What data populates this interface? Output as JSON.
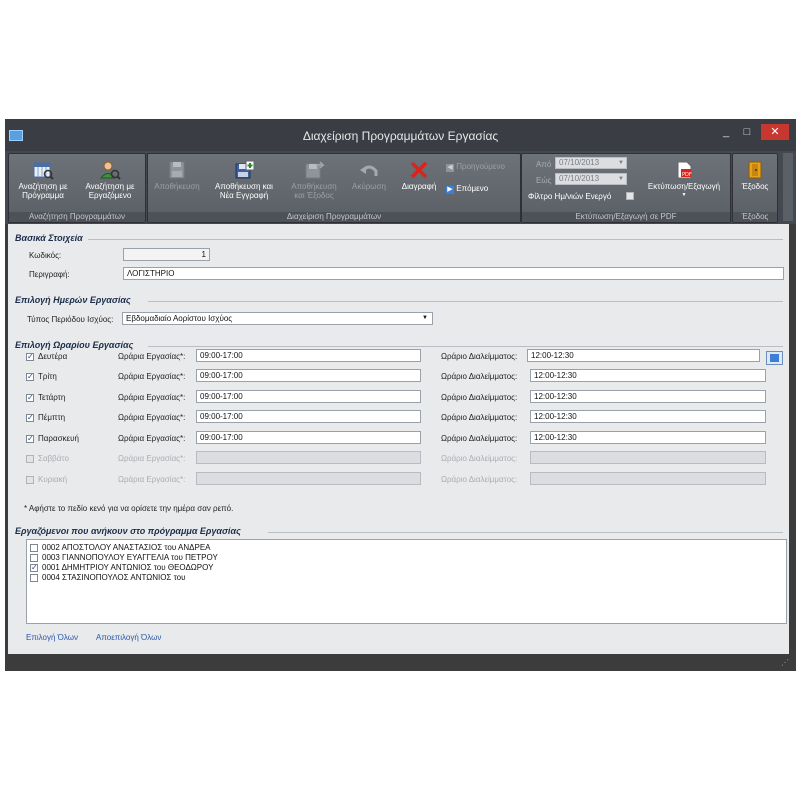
{
  "window": {
    "title": "Διαχείριση Προγραμμάτων Εργασίας",
    "minimize": "_",
    "maximize": "□",
    "close": "✕"
  },
  "ribbon": {
    "groups": {
      "search": "Αναζήτηση Προγραμμάτων",
      "manage": "Διαχείριση Προγραμμάτων",
      "print": "Εκτύπωση/Εξαγωγή σε PDF",
      "exit": "Έξοδος"
    },
    "buttons": {
      "search_program": [
        "Αναζήτηση με",
        "Πρόγραμμα"
      ],
      "search_employee": [
        "Αναζήτηση με",
        "Εργαζόμενο"
      ],
      "save": "Αποθήκευση",
      "save_new": [
        "Αποθήκευση και",
        "Νέα Εγγραφή"
      ],
      "save_exit": [
        "Αποθήκευση",
        "και Έξοδος"
      ],
      "cancel": "Ακύρωση",
      "delete": "Διαγραφή",
      "previous": "Προηγούμενο",
      "next": "Επόμενο",
      "from_label": "Από",
      "from_value": "07/10/2013",
      "to_label": "Εώς",
      "to_value": "07/10/2013",
      "date_filter": "Φίλτρο Ημ/νιών Ενεργό",
      "print_export": "Εκτύπωση/Εξαγωγή",
      "exit": "Έξοδος"
    }
  },
  "basic": {
    "header": "Βασικά Στοιχεία",
    "code_label": "Κωδικός:",
    "code_value": "1",
    "desc_label": "Περιγραφή:",
    "desc_value": "ΛΟΓΙΣΤΗΡΙΟ"
  },
  "days_section": {
    "header": "Επιλογή Ημερών Εργασίας",
    "period_label": "Τύπος Περιόδου Ισχύος:",
    "period_value": "Εβδομαδιαίο Αορίστου Ισχύος"
  },
  "schedule": {
    "header": "Επιλογή Ωραρίου Εργασίας",
    "work_label": "Ωράρια Εργασίας*:",
    "break_label": "Ωράριο Διαλείμματος:",
    "rows": [
      {
        "day": "Δευτέρα",
        "checked": "✓",
        "work": "09:00-17:00",
        "break": "12:00-12:30"
      },
      {
        "day": "Τρίτη",
        "checked": "✓",
        "work": "09:00-17:00",
        "break": "12:00-12:30"
      },
      {
        "day": "Τετάρτη",
        "checked": "✓",
        "work": "09:00-17:00",
        "break": "12:00-12:30"
      },
      {
        "day": "Πέμπτη",
        "checked": "✓",
        "work": "09:00-17:00",
        "break": "12:00-12:30"
      },
      {
        "day": "Παρασκευή",
        "checked": "✓",
        "work": "09:00-17:00",
        "break": "12:00-12:30"
      },
      {
        "day": "Σαββάτο",
        "checked": "",
        "work": "",
        "break": ""
      },
      {
        "day": "Κυριακή",
        "checked": "",
        "work": "",
        "break": ""
      }
    ],
    "note": "* Αφήστε το πεδίο κενό για να ορίσετε την ημέρα σαν ρεπό."
  },
  "employees": {
    "header": "Εργαζόμενοι που ανήκουν στο πρόγραμμα Εργασίας",
    "items": [
      {
        "checked": "",
        "name": "0002 ΑΠΟΣΤΟΛΟΥ ΑΝΑΣΤΑΣΙΟΣ του ΑΝΔΡΕΑ"
      },
      {
        "checked": "",
        "name": "0003 ΓΙΑΝΝΟΠΟΥΛΟΥ ΕΥΑΓΓΕΛΙΑ του ΠΕΤΡΟΥ"
      },
      {
        "checked": "✓",
        "name": "0001 ΔΗΜΗΤΡΙΟΥ ΑΝΤΩΝΙΟΣ του ΘΕΟΔΩΡΟΥ"
      },
      {
        "checked": "",
        "name": "0004 ΣΤΑΣΙΝΟΠΟΥΛΟΣ ΑΝΤΩΝΙΟΣ του"
      }
    ],
    "select_all": "Επιλογή Όλων",
    "deselect_all": "Αποεπιλογή Όλων"
  },
  "colors": {
    "accent": "#2a58a8",
    "titlebar": "#3a3d43",
    "close": "#c7372f"
  }
}
